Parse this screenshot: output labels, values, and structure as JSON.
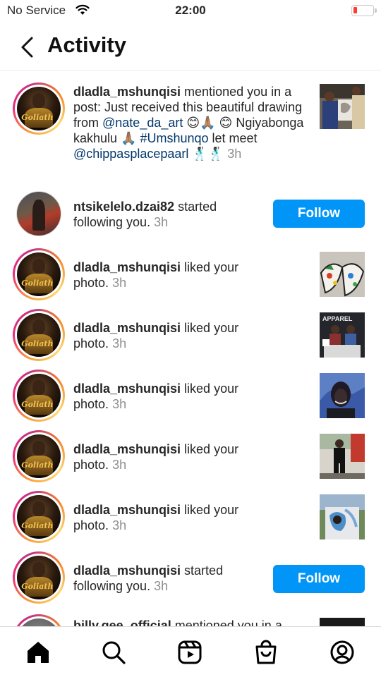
{
  "status_bar": {
    "carrier": "No Service",
    "time": "22:00"
  },
  "header": {
    "title": "Activity"
  },
  "notifications": [
    {
      "user": "dladla_mshunqisi",
      "text_before": " mentioned you in a post: Just received this beautiful drawing  from ",
      "link1": "@nate_da_art",
      "text_mid": " 😊🙏🏽 😊 Ngiyabonga kakhulu 🙏🏽 ",
      "hashtag": "#Umshunqo",
      "text_mid2": " let meet ",
      "link2": "@chippasplacepaarl",
      "text_end": " 🕺🏿🕺🏿 ",
      "time": "3h"
    },
    {
      "user": "ntsikelelo.dzai82",
      "action": " started following you.",
      "time": "3h",
      "button": "Follow"
    },
    {
      "user": "dladla_mshunqisi",
      "action": " liked your photo.",
      "time": "3h"
    },
    {
      "user": "dladla_mshunqisi",
      "action": " liked your photo.",
      "time": "3h"
    },
    {
      "user": "dladla_mshunqisi",
      "action": " liked your photo.",
      "time": "3h"
    },
    {
      "user": "dladla_mshunqisi",
      "action": " liked your photo.",
      "time": "3h"
    },
    {
      "user": "dladla_mshunqisi",
      "action": " liked your photo.",
      "time": "3h"
    },
    {
      "user": "dladla_mshunqisi",
      "action": " started following you.",
      "time": "3h",
      "button": "Follow"
    },
    {
      "user": "billy.gee_official",
      "action": " mentioned you in a"
    }
  ],
  "avatar_logo_text": "Goliath",
  "thumb_text": {
    "apparel": "APPAREL"
  },
  "tabs": [
    "home-icon",
    "search-icon",
    "reels-icon",
    "shop-icon",
    "profile-icon"
  ],
  "colors": {
    "follow_blue": "#0095f6",
    "link": "#00376b",
    "muted": "#8e8e8e"
  }
}
